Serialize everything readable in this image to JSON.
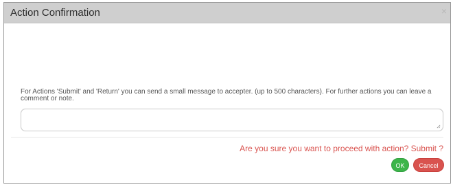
{
  "dialog": {
    "title": "Action Confirmation",
    "close_symbol": "×",
    "message": "For Actions 'Submit' and 'Return' you can send a small message to accepter. (up to 500 characters). For further actions you can leave a comment or note.",
    "note": {
      "value": "",
      "placeholder": ""
    },
    "confirm_text": "Are you sure you want to proceed with action? Submit ?",
    "buttons": {
      "ok_label": "OK",
      "cancel_label": "Cancel"
    }
  },
  "colors": {
    "header_bg": "#cfcfcf",
    "confirm_text": "#d9534f",
    "ok_button": "#3cb54a",
    "cancel_button": "#d9534f"
  },
  "icons": {
    "close": "close-icon",
    "resize": "resize-grip-icon"
  }
}
